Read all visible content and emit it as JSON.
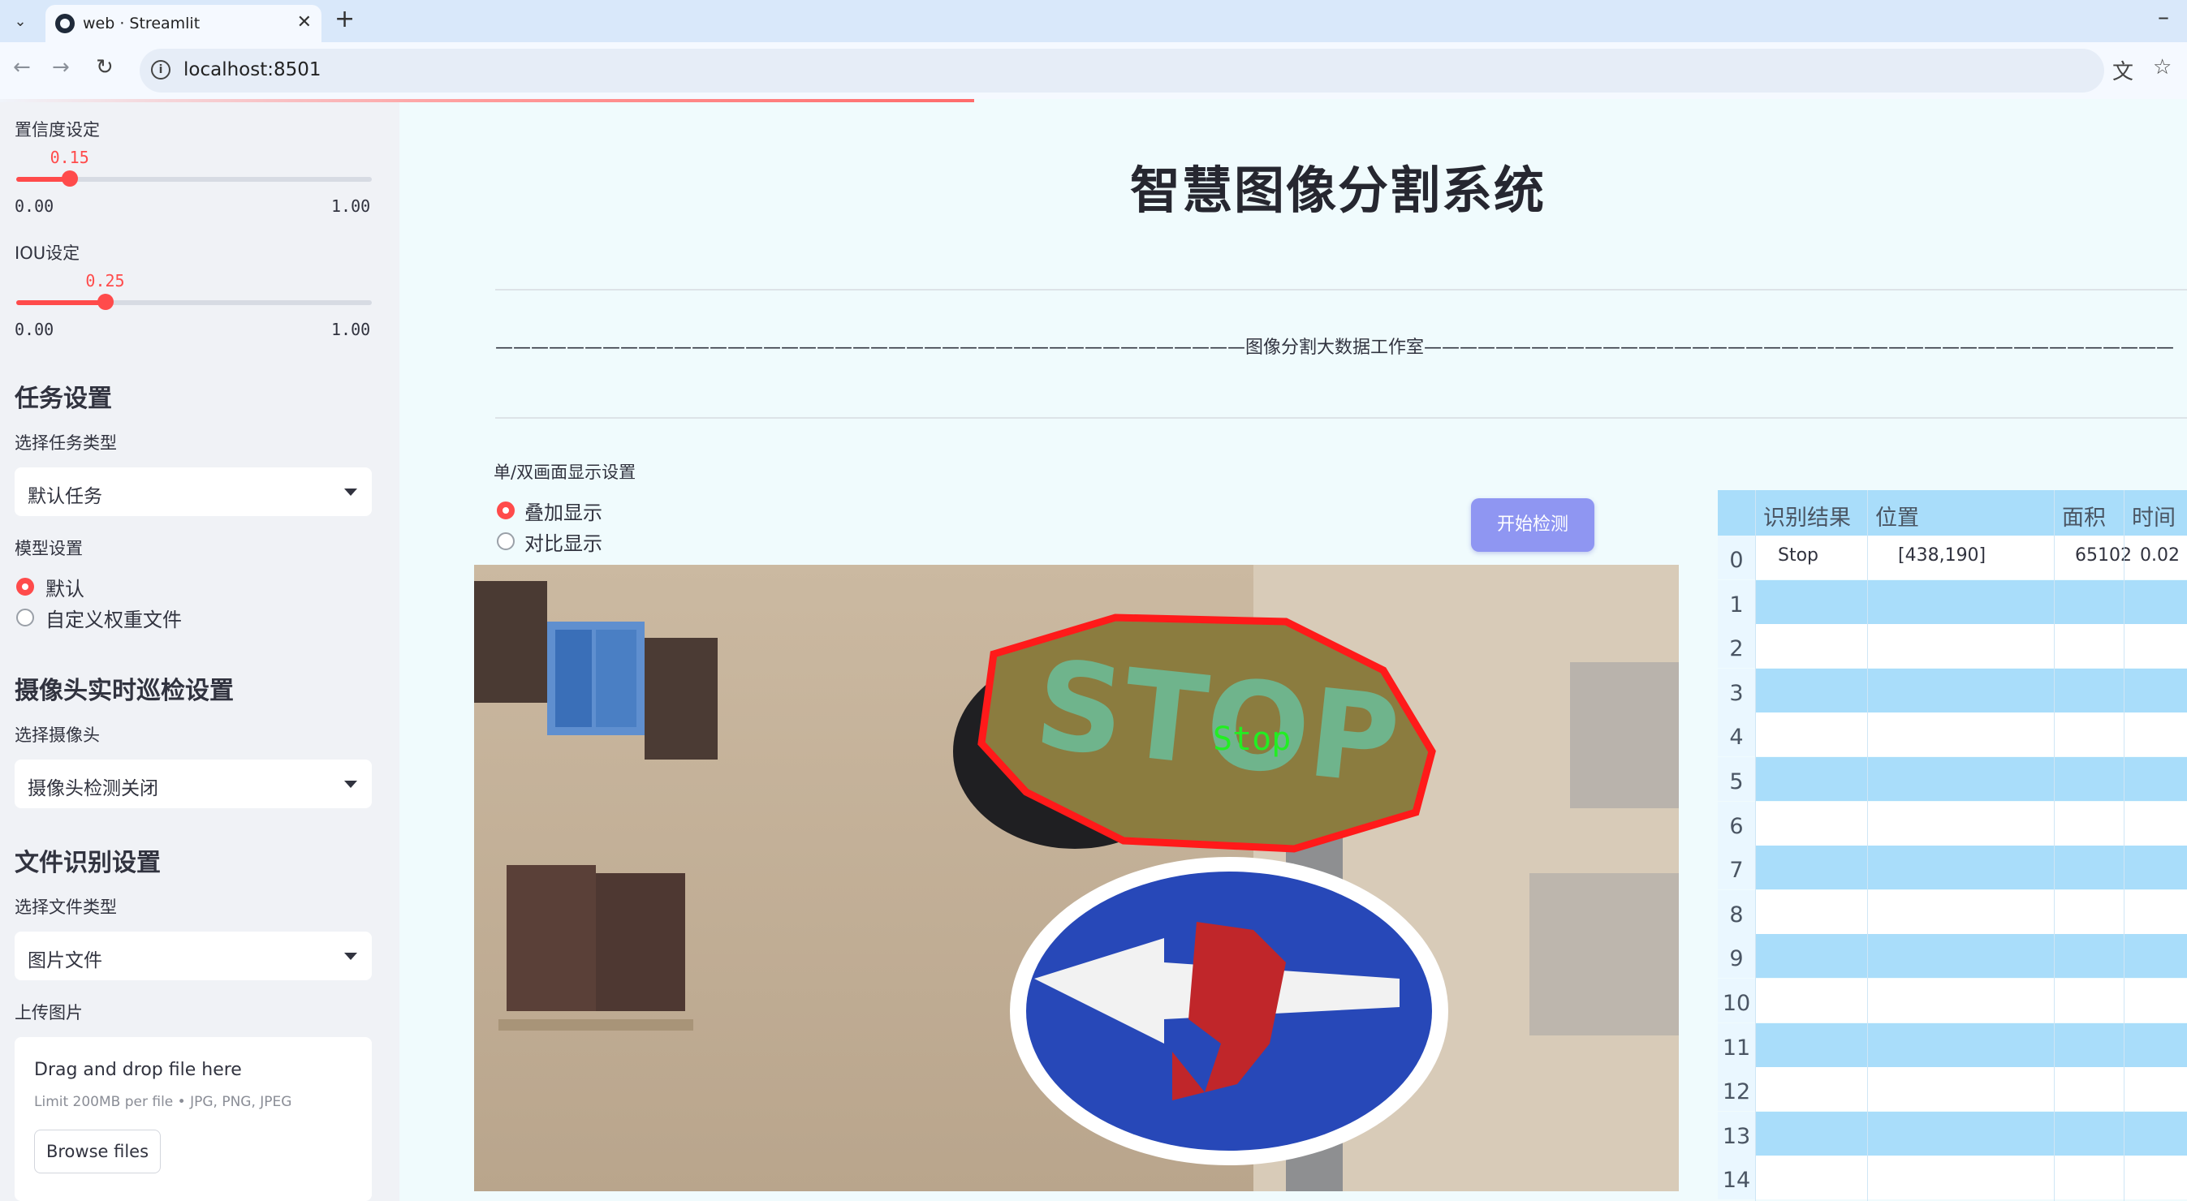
{
  "browser": {
    "tab_title": "web · Streamlit",
    "url": "localhost:8501"
  },
  "sidebar": {
    "confidence": {
      "label": "置信度设定",
      "value": 0.15,
      "value_text": "0.15",
      "min": "0.00",
      "max": "1.00"
    },
    "iou": {
      "label": "IOU设定",
      "value": 0.25,
      "value_text": "0.25",
      "min": "0.00",
      "max": "1.00"
    },
    "task_section": {
      "title": "任务设置",
      "type_label": "选择任务类型",
      "type_value": "默认任务"
    },
    "model_section": {
      "label": "模型设置",
      "options": [
        "默认",
        "自定义权重文件"
      ],
      "selected": 0
    },
    "camera_section": {
      "title": "摄像头实时巡检设置",
      "label": "选择摄像头",
      "value": "摄像头检测关闭"
    },
    "file_section": {
      "title": "文件识别设置",
      "type_label": "选择文件类型",
      "type_value": "图片文件",
      "upload_label": "上传图片"
    },
    "uploader": {
      "drop_text": "Drag and drop file here",
      "limit_text": "Limit 200MB per file • JPG, PNG, JPEG",
      "browse_label": "Browse files"
    }
  },
  "main": {
    "title": "智慧图像分割系统",
    "studio_line": "——————————————————————————————————————————图像分割大数据工作室——————————————————————————————————————————",
    "display_mode": {
      "label": "单/双画面显示设置",
      "options": [
        "叠加显示",
        "对比显示"
      ],
      "selected": 0
    },
    "start_button": "开始检测",
    "detection_label": "Stop",
    "colors": {
      "accent": "#ff4b4b",
      "button": "#8f96f2",
      "table_stripe": "#a9ddfa"
    }
  },
  "table": {
    "columns": [
      "识别结果",
      "位置",
      "面积",
      "时间"
    ],
    "rows": [
      {
        "id": "0",
        "result": "Stop",
        "position": "[438,190]",
        "area": "65102",
        "time": "0.02"
      },
      {
        "id": "1",
        "result": "",
        "position": "",
        "area": "",
        "time": ""
      },
      {
        "id": "2",
        "result": "",
        "position": "",
        "area": "",
        "time": ""
      },
      {
        "id": "3",
        "result": "",
        "position": "",
        "area": "",
        "time": ""
      },
      {
        "id": "4",
        "result": "",
        "position": "",
        "area": "",
        "time": ""
      },
      {
        "id": "5",
        "result": "",
        "position": "",
        "area": "",
        "time": ""
      },
      {
        "id": "6",
        "result": "",
        "position": "",
        "area": "",
        "time": ""
      },
      {
        "id": "7",
        "result": "",
        "position": "",
        "area": "",
        "time": ""
      },
      {
        "id": "8",
        "result": "",
        "position": "",
        "area": "",
        "time": ""
      },
      {
        "id": "9",
        "result": "",
        "position": "",
        "area": "",
        "time": ""
      },
      {
        "id": "10",
        "result": "",
        "position": "",
        "area": "",
        "time": ""
      },
      {
        "id": "11",
        "result": "",
        "position": "",
        "area": "",
        "time": ""
      },
      {
        "id": "12",
        "result": "",
        "position": "",
        "area": "",
        "time": ""
      },
      {
        "id": "13",
        "result": "",
        "position": "",
        "area": "",
        "time": ""
      },
      {
        "id": "14",
        "result": "",
        "position": "",
        "area": "",
        "time": ""
      }
    ]
  }
}
